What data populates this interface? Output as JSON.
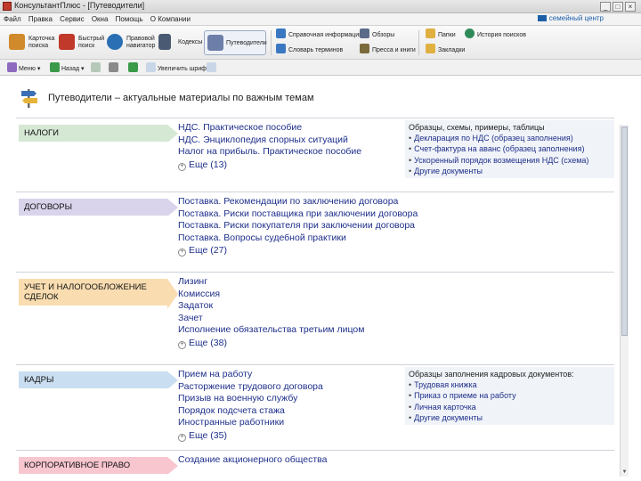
{
  "window": {
    "title": "КонсультантПлюс - [Путеводители]",
    "controls": [
      "_",
      "□",
      "×"
    ]
  },
  "menubar": {
    "items": [
      "Файл",
      "Правка",
      "Сервис",
      "Окна",
      "Помощь",
      "О Компании"
    ],
    "brand": "семейный центр"
  },
  "toolbar": {
    "big": [
      {
        "label": "Карточка\nпоиска",
        "icon": "search-card-icon",
        "color": "#d08a2b"
      },
      {
        "label": "Быстрый\nпоиск",
        "icon": "quick-search-icon",
        "color": "#c0392b"
      },
      {
        "label": "Правовой\nнавигатор",
        "icon": "navigator-icon",
        "color": "#2a6fb4"
      },
      {
        "label": "Кодексы",
        "icon": "codes-icon",
        "color": "#4b5a73"
      },
      {
        "label": "Путеводители",
        "icon": "guides-icon",
        "color": "#6d7fa8"
      }
    ],
    "small": [
      {
        "label": "Справочная информация",
        "icon": "reference-icon",
        "color": "#3a78c2"
      },
      {
        "label": "Словарь терминов",
        "icon": "dictionary-icon",
        "color": "#3a78c2"
      },
      {
        "label": "Обзоры",
        "icon": "reviews-icon",
        "color": "#5b6b8a"
      },
      {
        "label": "Пресса и книги",
        "icon": "press-icon",
        "color": "#7b6a3a"
      },
      {
        "label": "Папки",
        "icon": "folders-icon",
        "color": "#e0b040"
      },
      {
        "label": "Закладки",
        "icon": "bookmarks-icon",
        "color": "#e0b040"
      },
      {
        "label": "История поисков",
        "icon": "history-icon",
        "color": "#2f8a5a"
      }
    ]
  },
  "toolbar2": {
    "menu_label": "Меню",
    "back_label": "Назад",
    "edition_label": "Увеличить шрифт"
  },
  "page": {
    "title": "Путеводители – актуальные материалы по важным темам"
  },
  "sections": [
    {
      "category": "НАЛОГИ",
      "links": [
        "НДС. Практическое пособие",
        "НДС. Энциклопедия спорных ситуаций",
        "Налог на прибыль. Практическое пособие"
      ],
      "more": "Еще (13)",
      "side": {
        "heading": "Образцы, схемы, примеры, таблицы",
        "items": [
          "Декларация по НДС (образец заполнения)",
          "Счет-фактура на аванс (образец заполнения)",
          "Ускоренный порядок возмещения НДС (схема)",
          "Другие документы"
        ]
      }
    },
    {
      "category": "ДОГОВОРЫ",
      "links": [
        "Поставка. Рекомендации по заключению договора",
        "Поставка. Риски поставщика при заключении договора",
        "Поставка. Риски покупателя при заключении договора",
        "Поставка. Вопросы судебной практики"
      ],
      "more": "Еще (27)"
    },
    {
      "category": "УЧЕТ И НАЛОГООБЛОЖЕНИЕ СДЕЛОК",
      "links": [
        "Лизинг",
        "Комиссия",
        "Задаток",
        "Зачет",
        "Исполнение обязательства третьим лицом"
      ],
      "more": "Еще (38)"
    },
    {
      "category": "КАДРЫ",
      "links": [
        "Прием на работу",
        "Расторжение трудового договора",
        "Призыв на военную службу",
        "Порядок подсчета стажа",
        "Иностранные работники"
      ],
      "more": "Еще (35)",
      "side": {
        "heading": "Образцы заполнения кадровых документов:",
        "items": [
          "Трудовая книжка",
          "Приказ о приеме на работу",
          "Личная карточка",
          "Другие документы"
        ]
      }
    },
    {
      "category": "КОРПОРАТИВНОЕ ПРАВО",
      "links": [
        "Создание акционерного общества"
      ]
    }
  ]
}
